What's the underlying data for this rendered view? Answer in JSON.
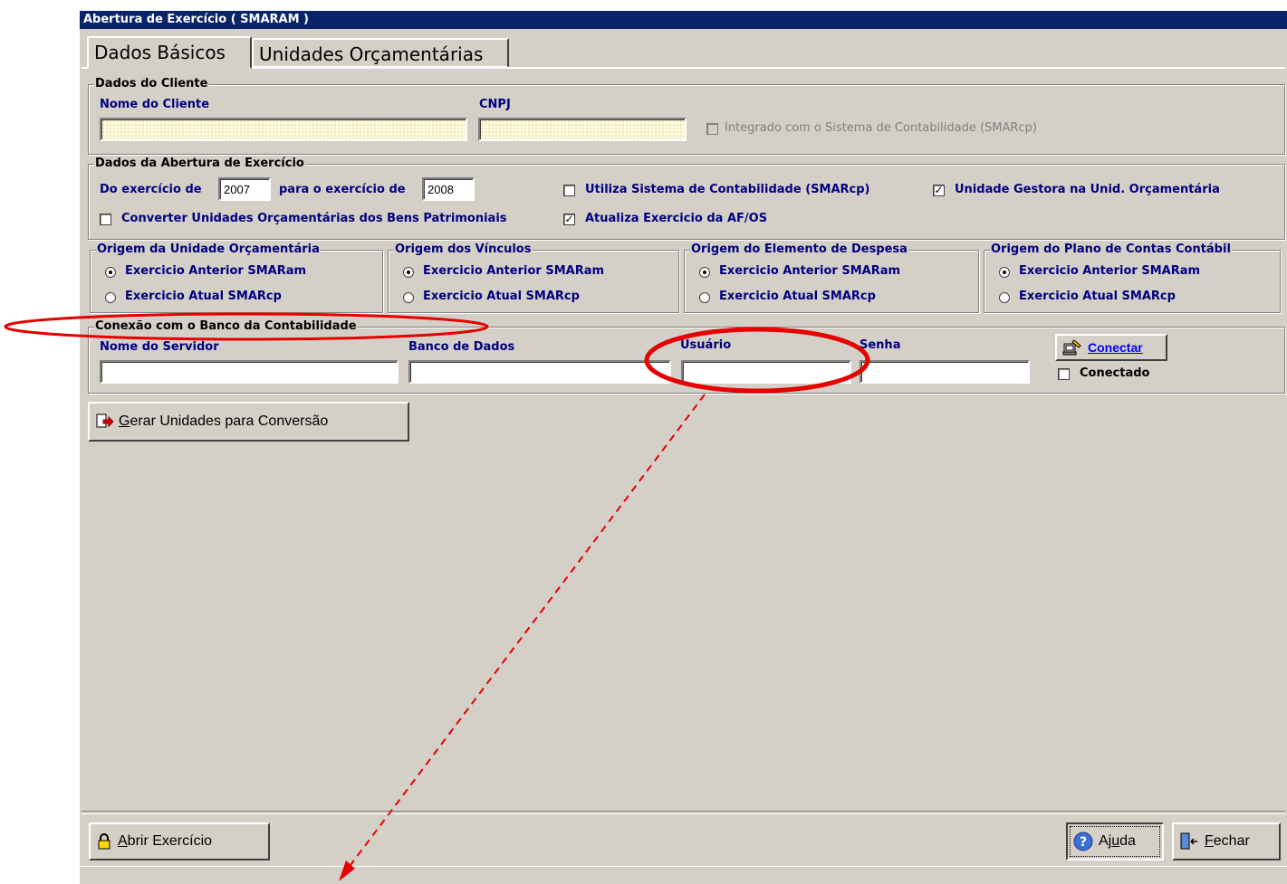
{
  "window": {
    "title": "Abertura de Exercício ( SMARAM )"
  },
  "tabs": [
    {
      "label": "Dados Básicos"
    },
    {
      "label": "Unidades Orçamentárias"
    }
  ],
  "cliente": {
    "legend": "Dados do Cliente",
    "nome_label": "Nome do Cliente",
    "nome_value": "",
    "cnpj_label": "CNPJ",
    "cnpj_value": "",
    "integrado_label": "Integrado com o Sistema de Contabilidade (SMARcp)",
    "integrado_checked": false
  },
  "abertura": {
    "legend": "Dados da Abertura de Exercício",
    "do_exercicio_label": "Do exercício de",
    "do_exercicio_value": "2007",
    "para_exercicio_label": "para o exercício de",
    "para_exercicio_value": "2008",
    "utiliza_label": "Utiliza Sistema de Contabilidade (SMARcp)",
    "utiliza_checked": false,
    "unidade_gestora_label": "Unidade Gestora na Unid. Orçamentária",
    "unidade_gestora_checked": true,
    "converter_label": "Converter Unidades Orçamentárias dos Bens Patrimoniais",
    "converter_checked": false,
    "atualiza_label": "Atualiza Exercicio da AF/OS",
    "atualiza_checked": true
  },
  "origens": [
    {
      "legend": "Origem da Unidade Orçamentária",
      "opt1": "Exercicio Anterior SMARam",
      "opt2": "Exercicio Atual SMARcp",
      "selected": 1
    },
    {
      "legend": "Origem dos Vínculos",
      "opt1": "Exercicio Anterior SMARam",
      "opt2": "Exercicio Atual SMARcp",
      "selected": 1
    },
    {
      "legend": "Origem do Elemento de Despesa",
      "opt1": "Exercicio Anterior SMARam",
      "opt2": "Exercicio Atual SMARcp",
      "selected": 1
    },
    {
      "legend": "Origem do Plano de Contas Contábil",
      "opt1": "Exercicio Anterior SMARam",
      "opt2": "Exercicio Atual SMARcp",
      "selected": 1
    }
  ],
  "conexao": {
    "legend": "Conexão com o Banco da Contabilidade",
    "servidor_label": "Nome do Servidor",
    "servidor_value": "",
    "banco_label": "Banco de Dados",
    "banco_value": "",
    "usuario_label": "Usuário",
    "usuario_value": "",
    "senha_label": "Senha",
    "senha_value": "",
    "conectar_label": "Conectar",
    "conectado_label": "Conectado",
    "conectado_checked": false
  },
  "buttons": {
    "gerar_prefix": "G",
    "gerar_rest": "erar Unidades para Conversão",
    "abrir_prefix": "A",
    "abrir_rest": "brir Exercício",
    "ajuda_pre": "Aj",
    "ajuda_u": "u",
    "ajuda_post": "da",
    "fechar_prefix": "F",
    "fechar_rest": "echar"
  },
  "annotation": {
    "color": "#e60000"
  }
}
